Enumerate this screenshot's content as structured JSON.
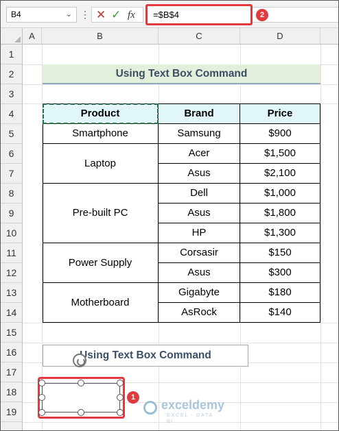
{
  "formula_bar": {
    "name_box": "B4",
    "dropdown_glyph": "⌄",
    "dots": "⋮",
    "cancel_icon": "✕",
    "enter_icon": "✓",
    "fx_label": "fx",
    "formula": "=$B$4",
    "callout_number": "2"
  },
  "columns": [
    "A",
    "B",
    "C",
    "D"
  ],
  "rows": [
    "1",
    "2",
    "3",
    "4",
    "5",
    "6",
    "7",
    "8",
    "9",
    "10",
    "11",
    "12",
    "13",
    "14",
    "15",
    "16",
    "17",
    "18",
    "19"
  ],
  "banner_title": "Using Text Box Command",
  "table": {
    "headers": [
      "Product",
      "Brand",
      "Price"
    ],
    "groups": [
      {
        "product": "Smartphone",
        "items": [
          {
            "brand": "Samsung",
            "price": "$900"
          }
        ]
      },
      {
        "product": "Laptop",
        "items": [
          {
            "brand": "Acer",
            "price": "$1,500"
          },
          {
            "brand": "Asus",
            "price": "$2,100"
          }
        ]
      },
      {
        "product": "Pre-built PC",
        "items": [
          {
            "brand": "Dell",
            "price": "$1,000"
          },
          {
            "brand": "Asus",
            "price": "$1,800"
          },
          {
            "brand": "HP",
            "price": "$1,300"
          }
        ]
      },
      {
        "product": "Power Supply",
        "items": [
          {
            "brand": "Corsasir",
            "price": "$150"
          },
          {
            "brand": "Asus",
            "price": "$300"
          }
        ]
      },
      {
        "product": "Motherboard",
        "items": [
          {
            "brand": "Gigabyte",
            "price": "$180"
          },
          {
            "brand": "AsRock",
            "price": "$140"
          }
        ]
      }
    ]
  },
  "text_box_title": "Using Text Box Command",
  "selected_box_callout": "1",
  "watermark": {
    "name": "exceldemy",
    "tagline": "EXCEL · DATA · BI"
  },
  "colors": {
    "accent_red": "#e03a3e",
    "header_fill": "#e0f6f9",
    "banner_fill": "#e2efda",
    "selection_green": "#217346"
  }
}
